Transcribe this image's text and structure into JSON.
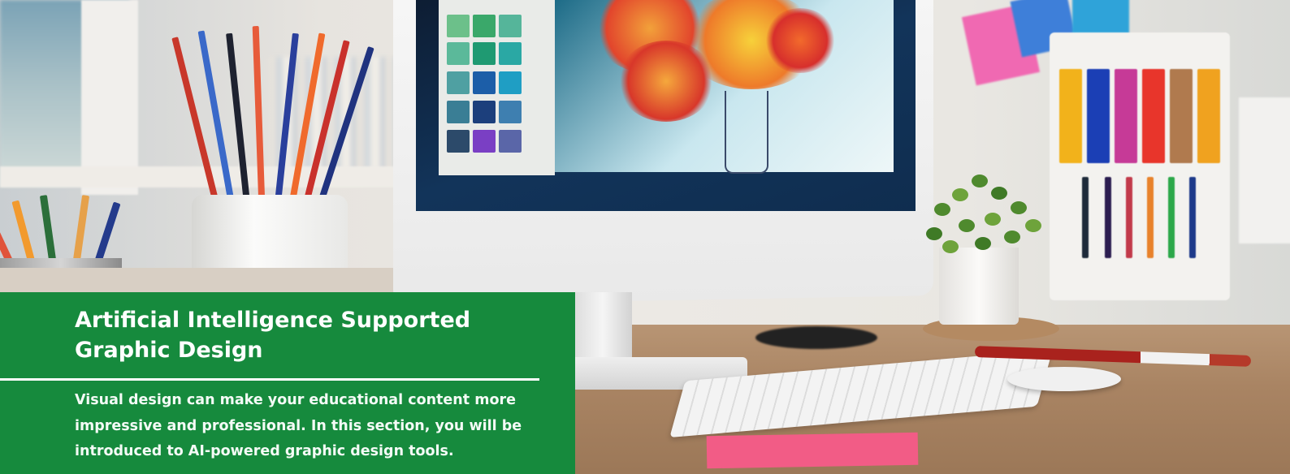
{
  "hero": {
    "scene_description_icon": "desk-workspace-photo",
    "colors": {
      "panel_background": "#168a3d",
      "panel_text": "#ffffff",
      "rule": "#ffffff"
    }
  },
  "info_panel": {
    "title_line_1": "Artificial Intelligence Supported",
    "title_line_2": "Graphic Design",
    "body": "Visual design can make your educational content more impressive and professional. In this section, you will be introduced to AI-powered graphic design tools."
  }
}
